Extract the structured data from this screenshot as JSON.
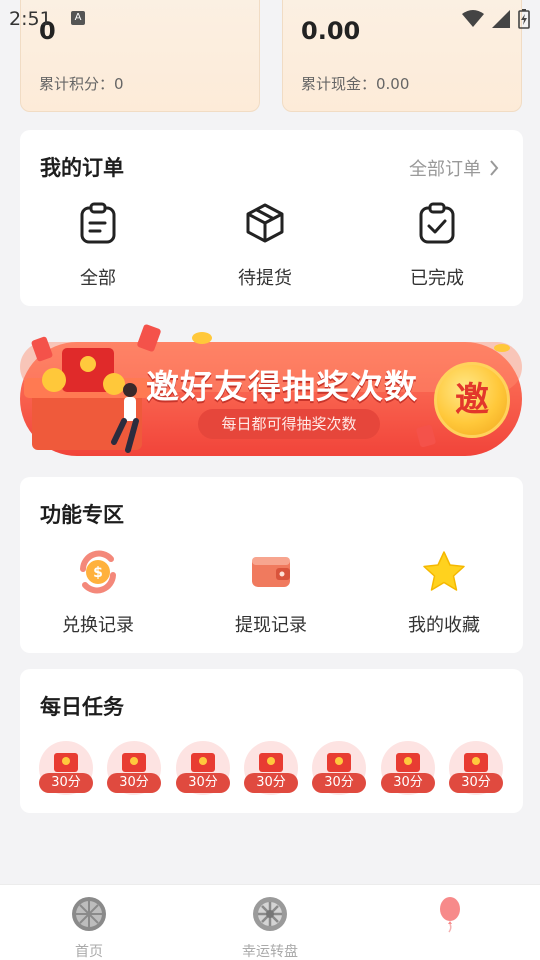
{
  "status_bar": {
    "time": "2:51",
    "notification_icon": "A"
  },
  "stats": {
    "points": {
      "value": "0",
      "label": "累计积分：0"
    },
    "cash": {
      "value": "0.00",
      "label": "累计现金：0.00"
    }
  },
  "orders": {
    "title": "我的订单",
    "all_link": "全部订单",
    "items": [
      {
        "label": "全部",
        "icon": "clipboard-list-icon"
      },
      {
        "label": "待提货",
        "icon": "package-box-icon"
      },
      {
        "label": "已完成",
        "icon": "clipboard-check-icon"
      }
    ]
  },
  "banner": {
    "title": "邀好友得抽奖次数",
    "subtitle": "每日都可得抽奖次数",
    "coin_text": "邀"
  },
  "functions": {
    "title": "功能专区",
    "items": [
      {
        "label": "兑换记录",
        "icon": "coin-exchange-icon"
      },
      {
        "label": "提现记录",
        "icon": "wallet-icon"
      },
      {
        "label": "我的收藏",
        "icon": "star-icon"
      }
    ]
  },
  "daily_tasks": {
    "title": "每日任务",
    "rewards": [
      "30分",
      "30分",
      "30分",
      "30分",
      "30分",
      "30分",
      "30分"
    ]
  },
  "tabs": [
    {
      "label": "首页",
      "icon": "orange-slice-icon"
    },
    {
      "label": "幸运转盘",
      "icon": "lucky-wheel-icon"
    },
    {
      "label": "",
      "icon": "balloon-icon"
    }
  ],
  "colors": {
    "accent_red": "#e83c32",
    "card_bg": "#ffffff",
    "stat_card_bg": "#fdebd8",
    "gold": "#ffc83a"
  }
}
